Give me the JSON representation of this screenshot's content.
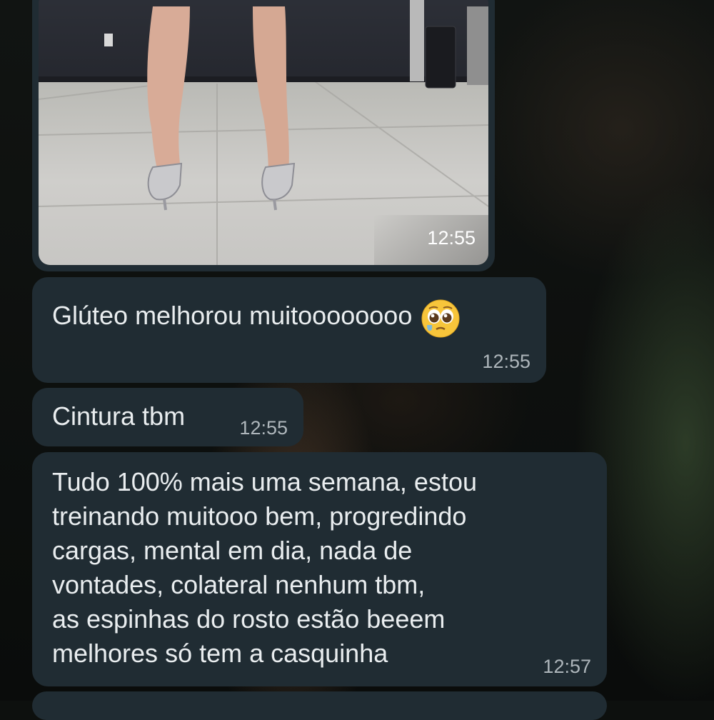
{
  "messages": [
    {
      "type": "image",
      "alt": "",
      "time": "12:55"
    },
    {
      "type": "text",
      "text": "Glúteo melhorou muitoooooooo",
      "emoji": "pleading-face-icon",
      "time": "12:55"
    },
    {
      "type": "text",
      "text": "Cintura tbm",
      "time": "12:55"
    },
    {
      "type": "text",
      "lines": [
        "Tudo 100% mais uma semana, estou",
        "treinando muitooo bem, progredindo",
        "cargas, mental em dia, nada de",
        "vontades, colateral nenhum tbm,",
        "as espinhas do rosto estão beeem",
        "melhores só tem a casquinha"
      ],
      "time": "12:57"
    }
  ],
  "colors": {
    "bubble": "#202c33",
    "text": "#e9edef",
    "timestamp": "#aeb6bb"
  }
}
